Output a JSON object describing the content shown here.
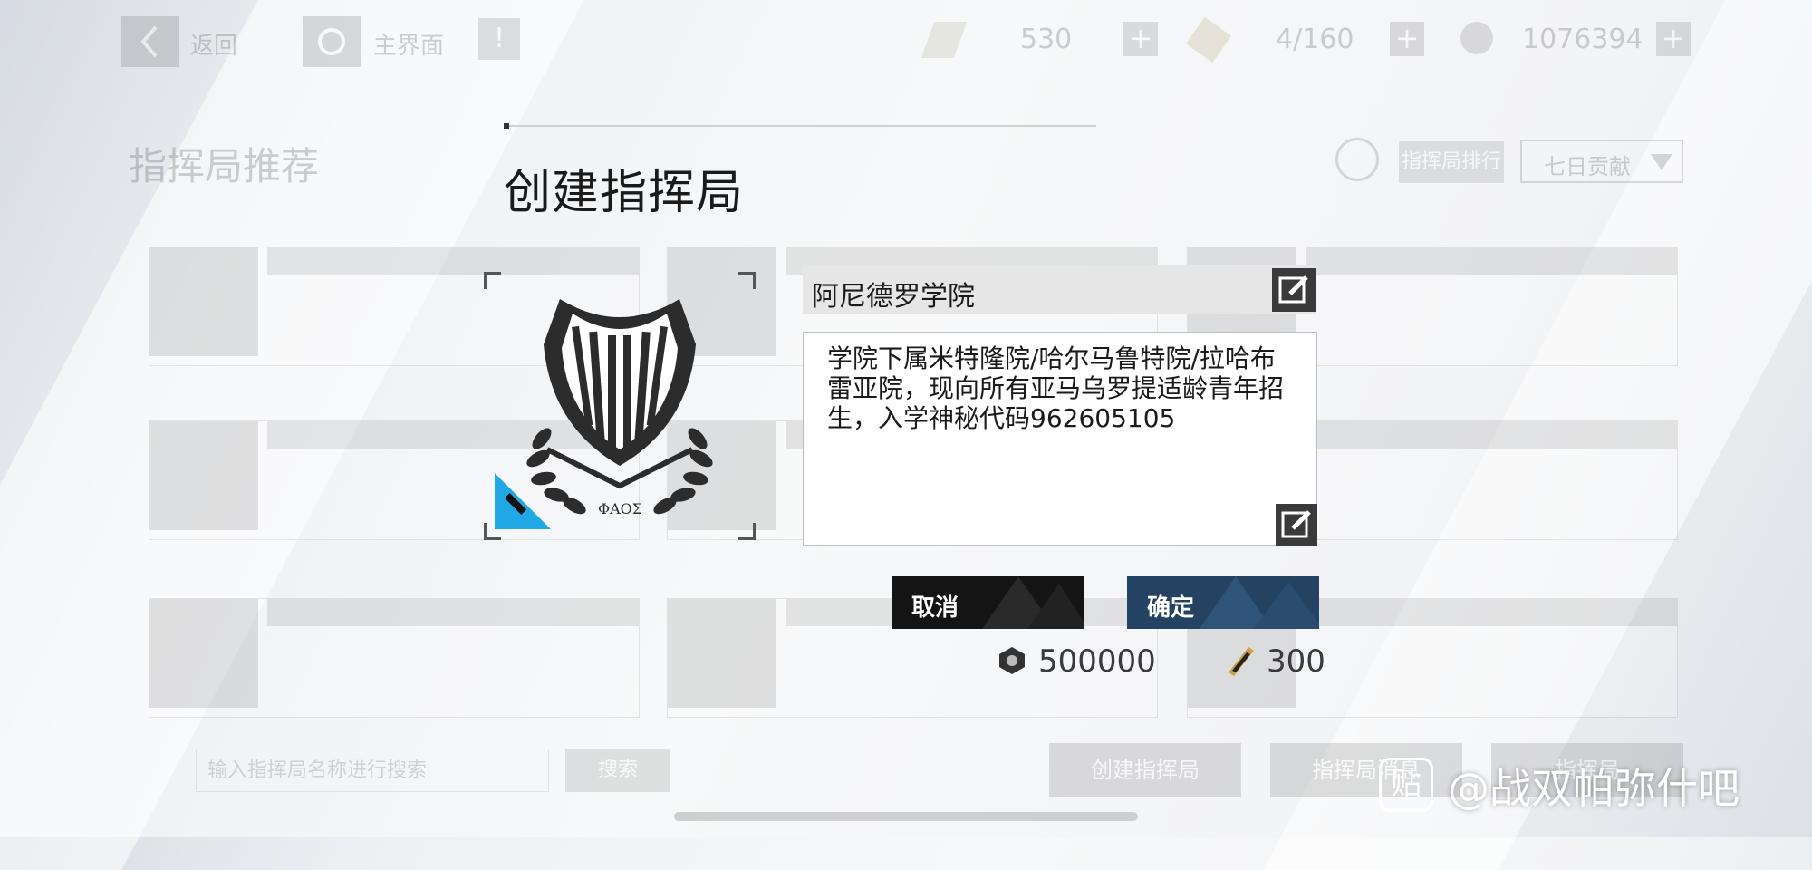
{
  "topbar": {
    "back_label": "返回",
    "home_label": "主界面",
    "stamina_value": "530",
    "energy_value": "4/160",
    "coins_value": "1076394",
    "plus_symbol": "+"
  },
  "background": {
    "title": "指挥局推荐",
    "ranking_label": "指挥局排行",
    "sort_value": "七日贡献",
    "search_placeholder": "输入指挥局名称进行搜索",
    "search_label": "搜索",
    "create_label": "创建指挥局",
    "list_label": "指挥局消息",
    "join_label": "指挥局"
  },
  "modal": {
    "title": "创建指挥局",
    "name": "阿尼德罗学院",
    "description": "学院下属米特隆院/哈尔马鲁特院/拉哈布雷亚院，现向所有亚马乌罗提适龄青年招生，入学神秘代码962605105",
    "emblem_text": "ΦΑΟΣ",
    "cancel_label": "取消",
    "confirm_label": "确定",
    "cost_coins": "500000",
    "cost_tickets": "300"
  },
  "watermark": {
    "text": "@战双帕弥什吧",
    "icon_text": "贴"
  },
  "colors": {
    "confirm_bg": "#244363",
    "cancel_bg": "#141414",
    "edit_tag": "#1fa7e6"
  }
}
